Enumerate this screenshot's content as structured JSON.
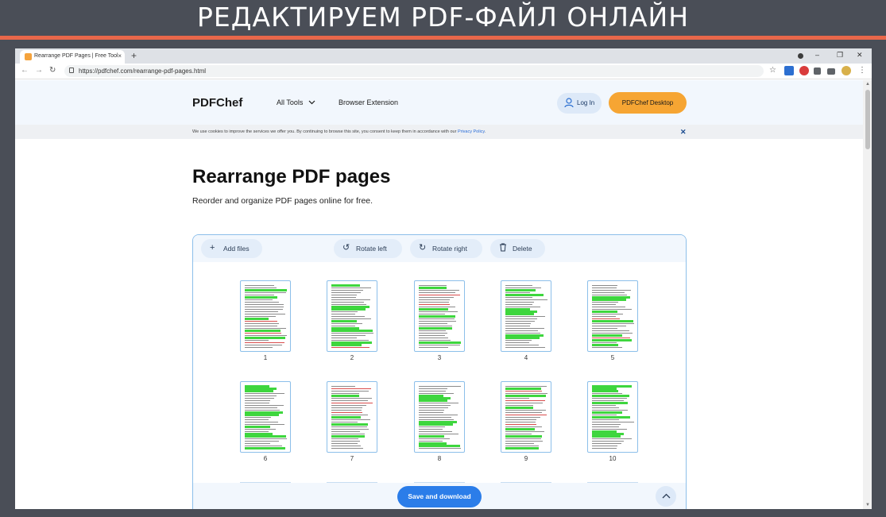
{
  "banner": {
    "title": "РЕДАКТИРУЕМ PDF-ФАЙЛ ОНЛАЙН"
  },
  "browser": {
    "tab_title": "Rearrange PDF Pages | Free Tool",
    "tab_close": "×",
    "new_tab": "+",
    "url": "https://pdfchef.com/rearrange-pdf-pages.html",
    "window_controls": {
      "minimize": "–",
      "maximize": "❐",
      "close": "✕"
    },
    "nav": {
      "back": "←",
      "forward": "→",
      "reload": "↻"
    },
    "star": "☆",
    "menu": "⋮"
  },
  "site": {
    "logo": "PDFChef",
    "nav": {
      "all_tools": "All Tools",
      "browser_extension": "Browser Extension"
    },
    "login": "Log In",
    "desktop": "PDFChef Desktop"
  },
  "cookie": {
    "text": "We use cookies to improve the services we offer you. By continuing to browse this site, you consent to keep them in accordance with our ",
    "link": "Privacy Policy",
    "end": ".",
    "close": "✕"
  },
  "main": {
    "title": "Rearrange PDF pages",
    "subtitle": "Reorder and organize PDF pages online for free."
  },
  "editor": {
    "add_files": "Add files",
    "rotate_left": "Rotate left",
    "rotate_right": "Rotate right",
    "delete": "Delete",
    "save": "Save and download",
    "pages": [
      {
        "label": "1"
      },
      {
        "label": "2"
      },
      {
        "label": "3"
      },
      {
        "label": "4"
      },
      {
        "label": "5"
      },
      {
        "label": "6"
      },
      {
        "label": "7"
      },
      {
        "label": "8"
      },
      {
        "label": "9"
      },
      {
        "label": "10"
      }
    ]
  },
  "colors": {
    "accent_blue": "#2b7de9",
    "accent_orange": "#f6a533",
    "banner_line": "#e8674a",
    "highlight_green": "#3ed63e"
  }
}
